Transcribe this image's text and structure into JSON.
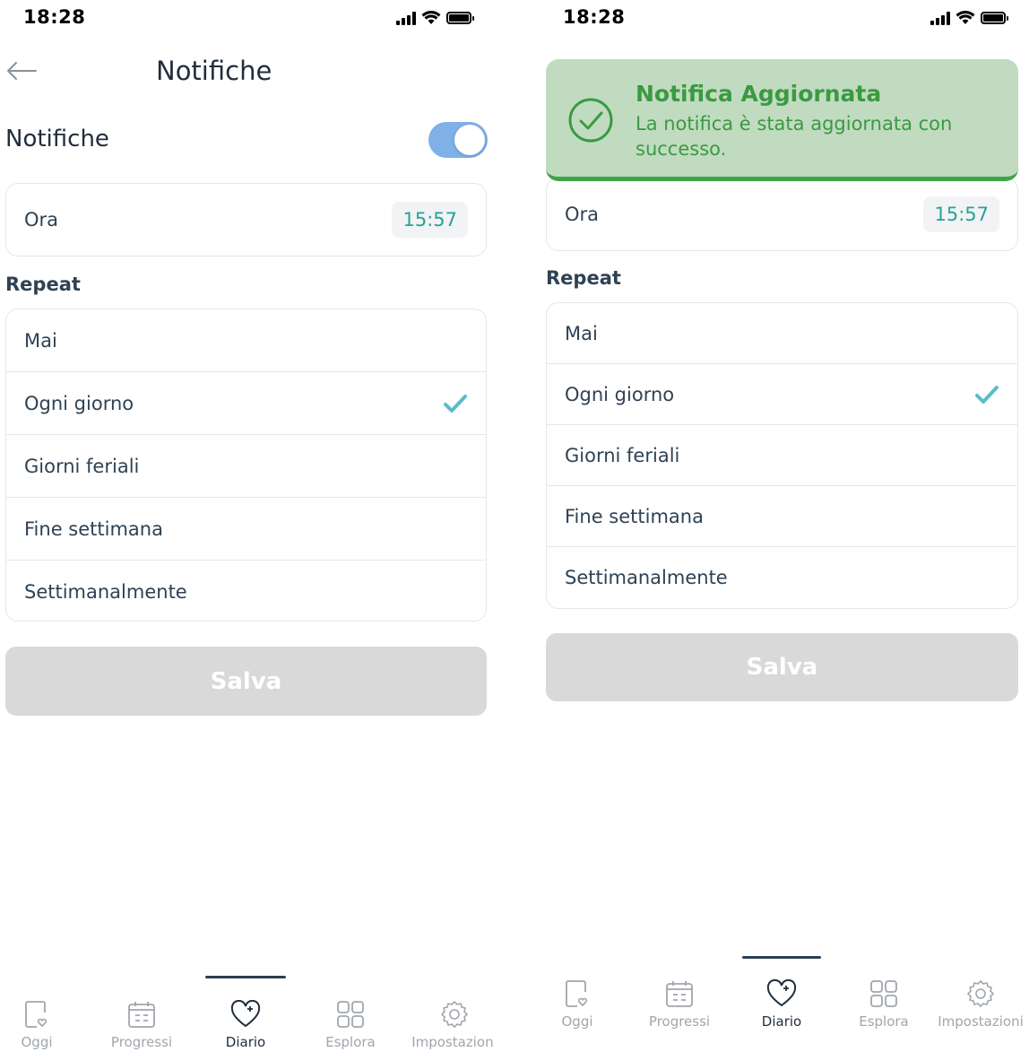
{
  "status_bar": {
    "time": "18:28"
  },
  "header": {
    "title": "Notifiche"
  },
  "notifications": {
    "label": "Notifiche",
    "enabled": true
  },
  "time_setting": {
    "label": "Ora",
    "value": "15:57"
  },
  "repeat": {
    "label": "Repeat",
    "options": [
      {
        "label": "Mai",
        "selected": false
      },
      {
        "label": "Ogni giorno",
        "selected": true
      },
      {
        "label": "Giorni feriali",
        "selected": false
      },
      {
        "label": "Fine settimana",
        "selected": false
      },
      {
        "label": "Settimanalmente",
        "selected": false
      }
    ]
  },
  "save_button": {
    "label": "Salva"
  },
  "toast": {
    "title": "Notifica Aggiornata",
    "message": "La notifica è stata aggiornata con successo."
  },
  "tabs": [
    {
      "label": "Oggi",
      "icon": "document-heart-icon",
      "active": false
    },
    {
      "label": "Progressi",
      "icon": "calendar-icon",
      "active": false
    },
    {
      "label": "Diario",
      "icon": "heart-plus-icon",
      "active": true
    },
    {
      "label": "Esplora",
      "icon": "grid-icon",
      "active": false
    },
    {
      "label": "Impostazioni",
      "icon": "gear-icon",
      "active": false
    }
  ],
  "colors": {
    "accent_teal": "#2aa198",
    "check_teal": "#5bbcc8",
    "toggle_blue": "#7fb0e8",
    "toast_bg": "#c1dbc0",
    "toast_text": "#3a9a42",
    "button_disabled": "#d9d9d9"
  }
}
